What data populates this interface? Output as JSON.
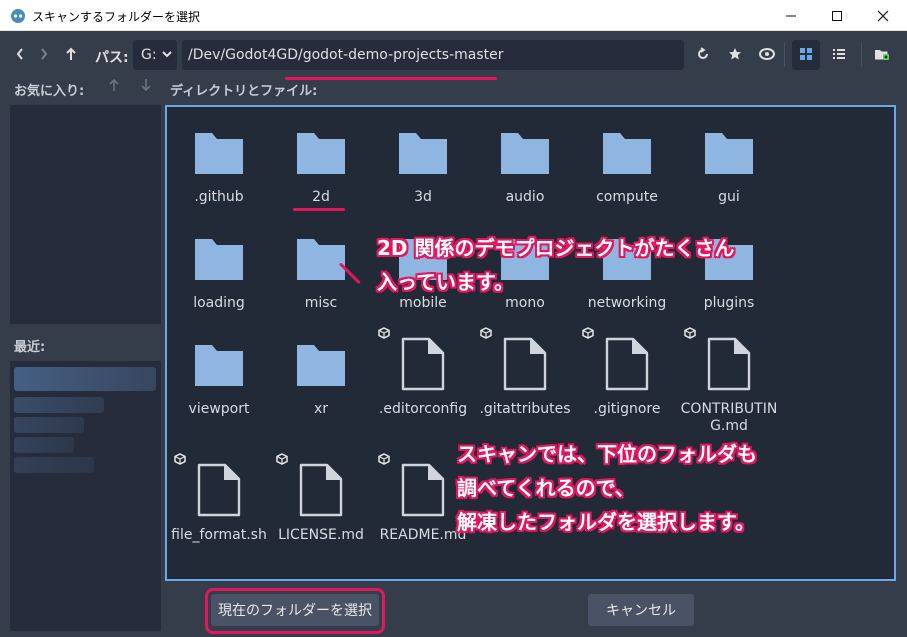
{
  "window": {
    "title": "スキャンするフォルダーを選択"
  },
  "toolbar": {
    "path_label": "パス:",
    "drive": "G:",
    "path": "/Dev/Godot4GD/godot-demo-projects-master"
  },
  "favorites": {
    "label": "お気に入り:"
  },
  "recent": {
    "label": "最近:"
  },
  "directory": {
    "label": "ディレクトリとファイル:"
  },
  "items": [
    {
      "name": ".github",
      "type": "folder"
    },
    {
      "name": "2d",
      "type": "folder"
    },
    {
      "name": "3d",
      "type": "folder"
    },
    {
      "name": "audio",
      "type": "folder"
    },
    {
      "name": "compute",
      "type": "folder"
    },
    {
      "name": "gui",
      "type": "folder"
    },
    {
      "name": "loading",
      "type": "folder"
    },
    {
      "name": "misc",
      "type": "folder"
    },
    {
      "name": "mobile",
      "type": "folder"
    },
    {
      "name": "mono",
      "type": "folder"
    },
    {
      "name": "networking",
      "type": "folder"
    },
    {
      "name": "plugins",
      "type": "folder"
    },
    {
      "name": "viewport",
      "type": "folder"
    },
    {
      "name": "xr",
      "type": "folder"
    },
    {
      "name": ".editorconfig",
      "type": "file"
    },
    {
      "name": ".gitattributes",
      "type": "file"
    },
    {
      "name": ".gitignore",
      "type": "file"
    },
    {
      "name": "CONTRIBUTIN\nG.md",
      "type": "file"
    },
    {
      "name": "file_format.sh",
      "type": "file"
    },
    {
      "name": "LICENSE.md",
      "type": "file"
    },
    {
      "name": "README.md",
      "type": "file"
    }
  ],
  "annotations": {
    "a1_line1": "2D 関係のデモプロジェクトがたくさん",
    "a1_line2": "入っています。",
    "a2_line1": "スキャンでは、下位のフォルダも",
    "a2_line2": "調べてくれるので、",
    "a2_line3": "解凍したフォルダを選択します。"
  },
  "buttons": {
    "select_current": "現在のフォルダーを選択",
    "cancel": "キャンセル"
  },
  "colors": {
    "accent": "#e3175e",
    "folder": "#8eb6e0",
    "panel_border": "#6ba9e6"
  }
}
